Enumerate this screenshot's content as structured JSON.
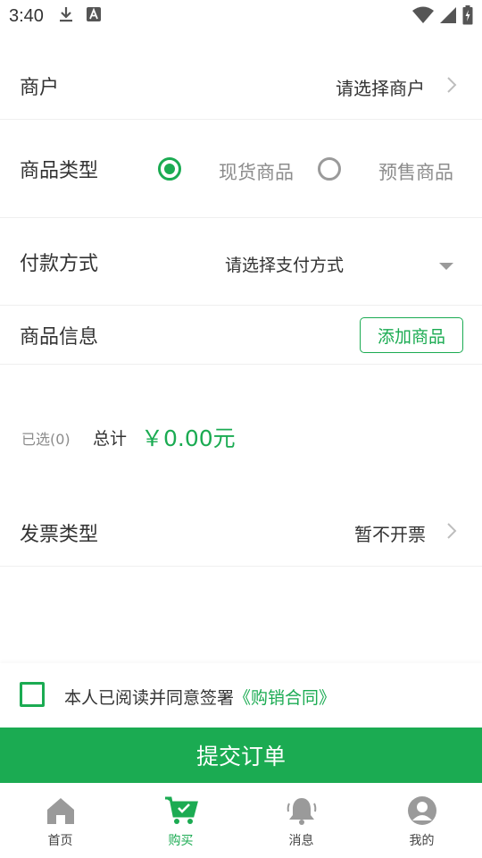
{
  "status_bar": {
    "time": "3:40"
  },
  "merchant": {
    "label": "商户",
    "value": "请选择商户"
  },
  "product_type": {
    "label": "商品类型",
    "options": [
      "现货商品",
      "预售商品"
    ],
    "selected": "现货商品"
  },
  "payment": {
    "label": "付款方式",
    "placeholder": "请选择支付方式"
  },
  "product_info": {
    "label": "商品信息",
    "add_button": "添加商品"
  },
  "summary": {
    "selected_count_text": "已选(0)",
    "total_label": "总计",
    "total_value": "￥0.00元"
  },
  "invoice": {
    "label": "发票类型",
    "value": "暂不开票"
  },
  "agreement": {
    "text": "本人已阅读并同意签署",
    "link": "《购销合同》"
  },
  "submit_button": "提交订单",
  "tabbar": {
    "tabs": [
      {
        "label": "首页",
        "icon": "home-icon"
      },
      {
        "label": "购买",
        "icon": "cart-icon"
      },
      {
        "label": "消息",
        "icon": "bell-icon"
      },
      {
        "label": "我的",
        "icon": "user-icon"
      }
    ],
    "active": "购买"
  },
  "colors": {
    "accent": "#1bab52",
    "muted": "#8c8c8c",
    "text": "#333333"
  }
}
